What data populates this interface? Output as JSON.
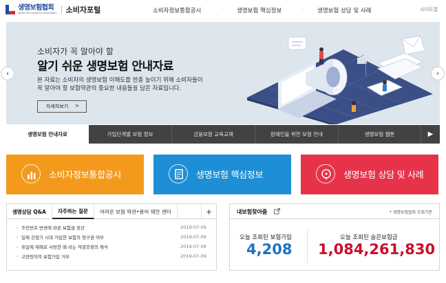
{
  "header": {
    "logo_name": "생명보험협회",
    "logo_sub": "Korea Life Insurance Association",
    "portal_title": "소비자포털",
    "nav": [
      "소비자정보통합공시",
      "생명보험 핵심정보",
      "생명보험 상담 및 사례"
    ],
    "sitemap": "사이트맵"
  },
  "hero": {
    "subtitle": "소비자가 꼭 알아야 할",
    "title": "알기 쉬운 생명보험 안내자료",
    "desc_line1": "본 자료는 소비자의 생명보험 이해도를 한층 높이기 위해 소비자들이",
    "desc_line2": "꼭 알아야 할 보험약관의 중요한 내용들을 담은 자료입니다.",
    "button_label": "자세히보기",
    "button_chevron": ">",
    "prev_arrow": "‹",
    "next_arrow": "›"
  },
  "tabs": [
    "생명보험 안내자료",
    "가입단계별 보험 정보",
    "금융보험 교육교재",
    "장애인을 위한 보험 안내",
    "생명보험 웹툰"
  ],
  "tab_play": "▶",
  "cards": [
    {
      "label": "소비자정보통합공시",
      "icon": "chart-icon",
      "color": "#f39a1d"
    },
    {
      "label": "생명보험 핵심정보",
      "icon": "document-icon",
      "color": "#1e8fd6"
    },
    {
      "label": "생명보험 상담 및 사례",
      "icon": "chat-icon",
      "color": "#e6334a"
    }
  ],
  "board": {
    "title": "생명상담 Q&A",
    "tabs": [
      "자주하는 질문",
      "어려운 보험 약관•용어 제안 센터"
    ],
    "plus": "+",
    "items": [
      {
        "text": "주민번호 변경에 따른 보험금 정산",
        "date": "2019-07-09"
      },
      {
        "text": "일제 강점기 시대 가입한 보험의 청구권 여부",
        "date": "2019-07-09"
      },
      {
        "text": "휴일에 재해로 사망한 때 라는 약관조항의 해석",
        "date": "2019-07-09"
      },
      {
        "text": "고연령자의 보험가입 거부",
        "date": "2019-07-09"
      }
    ]
  },
  "stats": {
    "title": "내보험찾아줌",
    "note": "* 생명보험협회 조회기준",
    "left_label": "오늘 조회된 보험가입",
    "left_value": "4,208",
    "left_color": "#1e73be",
    "right_label": "오늘 조회된 숨은보험금",
    "right_value": "1,084,261,830",
    "right_color": "#c8102e"
  }
}
